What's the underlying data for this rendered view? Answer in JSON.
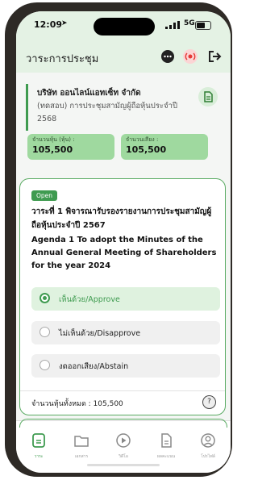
{
  "status_bar": {
    "time": "12:09",
    "network": "5G"
  },
  "header": {
    "title": "วาระการประชุม"
  },
  "company": {
    "name": "บริษัท ออนไลน์แอทเซ็ท จำกัด",
    "meeting": "(ทดสอบ) การประชุมสามัญผู้ถือหุ้นประจำปี 2568",
    "shares_label": "จำนวนหุ้น (หุ้น) :",
    "shares_value": "105,500",
    "votes_label": "จำนวนเสียง :",
    "votes_value": "105,500"
  },
  "agenda": {
    "status": "Open",
    "title_th": "วาระที่ 1 พิจารณารับรองรายงานการประชุมสามัญผู้ถือหุ้นประจำปี 2567",
    "title_en": "Agenda 1 To adopt the Minutes of the Annual General Meeting of Shareholders for the year 2024",
    "options": [
      {
        "label": "เห็นด้วย/Approve",
        "selected": true
      },
      {
        "label": "ไม่เห็นด้วย/Disapprove",
        "selected": false
      },
      {
        "label": "งดออกเสียง/Abstain",
        "selected": false
      }
    ],
    "total_shares": "จำนวนหุ้นทั้งหมด : 105,500"
  },
  "nav": {
    "items": [
      {
        "label": "วาระ",
        "icon": "agenda-icon",
        "active": true
      },
      {
        "label": "เอกสาร",
        "icon": "folder-icon",
        "active": false
      },
      {
        "label": "วิดีโอ",
        "icon": "play-icon",
        "active": false
      },
      {
        "label": "ผลคะแนน",
        "icon": "document-icon",
        "active": false
      },
      {
        "label": "โปรไฟล์",
        "icon": "profile-icon",
        "active": false
      }
    ]
  },
  "colors": {
    "accent": "#3f9b50",
    "header_bg": "#e4f2e4",
    "box_bg": "#9fd99f"
  }
}
